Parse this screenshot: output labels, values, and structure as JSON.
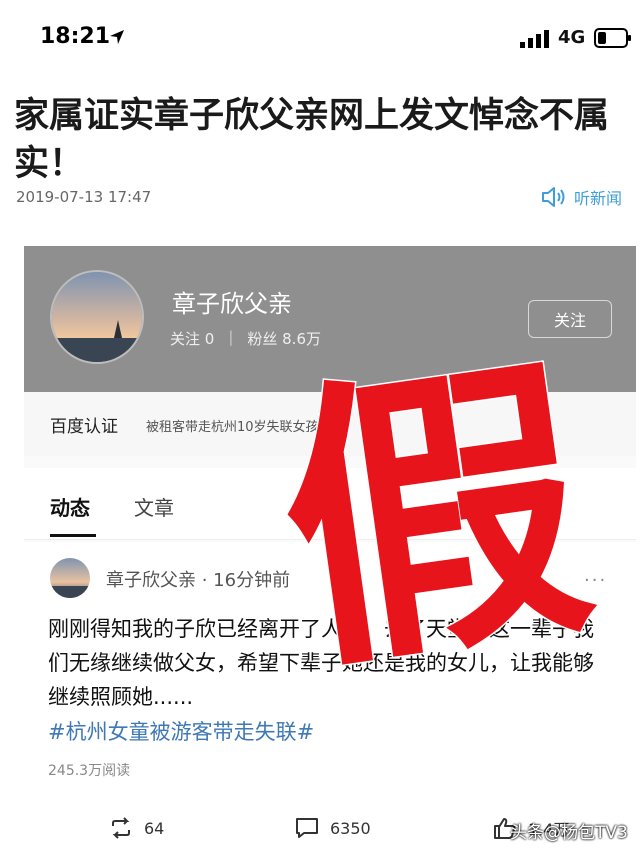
{
  "status_bar": {
    "time": "18:21",
    "network": "4G"
  },
  "article": {
    "title": "家属证实章子欣父亲网上发文悼念不属实！",
    "date": "2019-07-13 17:47",
    "listen_label": "听新闻"
  },
  "embed": {
    "profile": {
      "name": "章子欣父亲",
      "following": "关注 0",
      "fans": "粉丝 8.6万",
      "follow_button": "关注"
    },
    "verify": {
      "label": "百度认证",
      "desc": "被租客带走杭州10岁失联女孩父亲"
    },
    "tabs": [
      "动态",
      "文章"
    ],
    "post": {
      "author": "章子欣父亲 · 16分钟前",
      "more": "···",
      "body": "刚刚得知我的子欣已经离开了人世，去了天堂，这一辈子我们无缘继续做父女，希望下辈子她还是我的女儿，让我能够继续照顾她......",
      "tag": "#杭州女童被游客带走失联#",
      "reads": "245.3万阅读",
      "repost_count": "64",
      "comment_count": "6350",
      "like_count": "1.4万"
    }
  },
  "stamp": {
    "text": "假",
    "color": "#e8141c"
  },
  "watermark": "头条@杨包TV3",
  "colors": {
    "accent_blue": "#3f9ddb",
    "tag_blue": "#3e78b5",
    "profile_bg": "#8f8f8f"
  }
}
